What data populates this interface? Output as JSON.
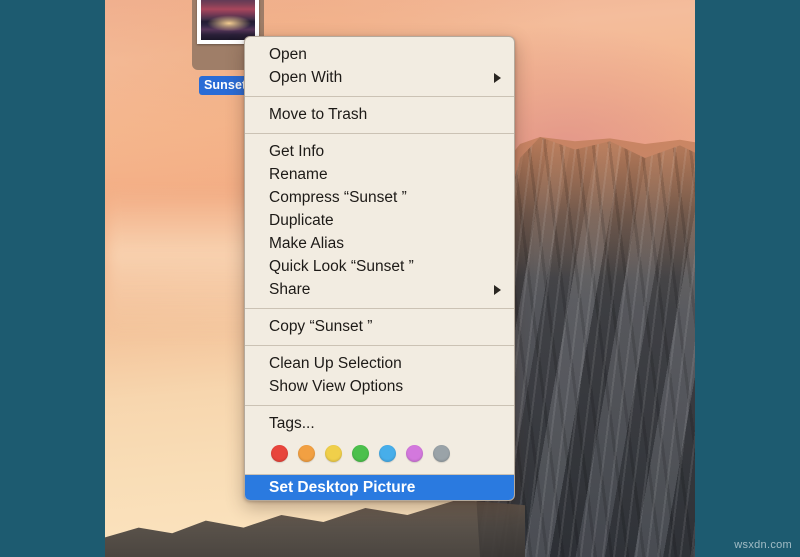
{
  "desktop": {
    "background_color": "#1d5b70",
    "wallpaper_name": "yosemite-sunset-wallpaper",
    "file": {
      "name_label": "Sunset",
      "thumbnail_name": "sunset-photo-thumbnail",
      "selected": true,
      "selection_color": "#2a6cd6"
    }
  },
  "context_menu": {
    "name": "finder-context-menu",
    "background_color": "#f2ece1",
    "highlight_color": "#2a7ae0",
    "groups": [
      {
        "items": [
          {
            "label": "Open",
            "submenu": false
          },
          {
            "label": "Open With",
            "submenu": true
          }
        ]
      },
      {
        "items": [
          {
            "label": "Move to Trash",
            "submenu": false
          }
        ]
      },
      {
        "items": [
          {
            "label": "Get Info",
            "submenu": false
          },
          {
            "label": "Rename",
            "submenu": false
          },
          {
            "label": "Compress “Sunset ”",
            "submenu": false
          },
          {
            "label": "Duplicate",
            "submenu": false
          },
          {
            "label": "Make Alias",
            "submenu": false
          },
          {
            "label": "Quick Look “Sunset ”",
            "submenu": false
          },
          {
            "label": "Share",
            "submenu": true
          }
        ]
      },
      {
        "items": [
          {
            "label": "Copy “Sunset ”",
            "submenu": false
          }
        ]
      },
      {
        "items": [
          {
            "label": "Clean Up Selection",
            "submenu": false
          },
          {
            "label": "Show View Options",
            "submenu": false
          }
        ]
      }
    ],
    "tags": {
      "label": "Tags...",
      "colors": [
        {
          "name": "red",
          "hex": "#e8453c"
        },
        {
          "name": "orange",
          "hex": "#f2a042"
        },
        {
          "name": "yellow",
          "hex": "#f0cf4a"
        },
        {
          "name": "green",
          "hex": "#4cc04c"
        },
        {
          "name": "blue",
          "hex": "#47aeea"
        },
        {
          "name": "purple",
          "hex": "#d378dd"
        },
        {
          "name": "gray",
          "hex": "#9aa3a8"
        }
      ]
    },
    "highlighted_item": {
      "label": "Set Desktop Picture"
    }
  },
  "watermark": {
    "text": "wsxdn.com"
  }
}
